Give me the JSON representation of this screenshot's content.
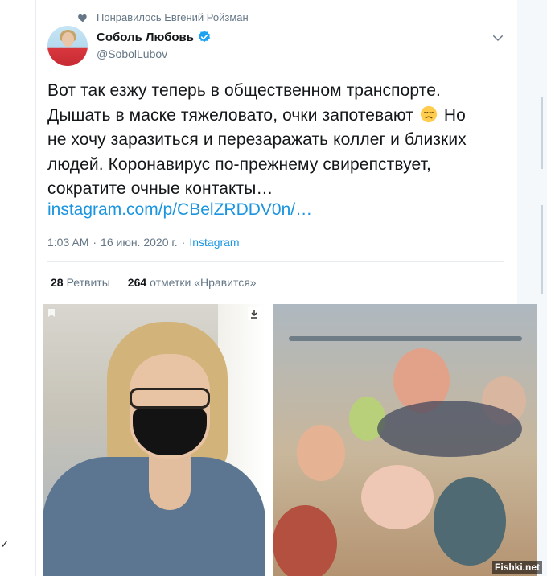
{
  "social_context": {
    "text": "Понравилось Евгений Ройзман",
    "icon": "heart-icon"
  },
  "author": {
    "name": "Соболь Любовь",
    "handle": "@SobolLubov",
    "verified": true
  },
  "tweet": {
    "line1": "Вот так езжу теперь в общественном транспорте.",
    "line2_before_emoji": "Дышать в маске тяжеловато, очки запотевают",
    "line2_after_emoji": "Но",
    "line3": "не хочу заразиться и перезаражать коллег и близких",
    "line4": "людей. Коронавирус по-прежнему свирепствует,",
    "line5": "сократите очные контакты…",
    "emoji": "disappointed-face",
    "link": "instagram.com/p/CBelZRDDV0n/…"
  },
  "meta": {
    "time": "1:03 AM",
    "separator": "·",
    "date": "16 июн. 2020 г.",
    "source": "Instagram"
  },
  "stats": {
    "retweets_count": "28",
    "retweets_label": "Ретвиты",
    "likes_count": "264",
    "likes_label": "отметки «Нравится»"
  },
  "watermark": "Fishki.net",
  "colors": {
    "link": "#1b95e0",
    "secondary": "#657786",
    "verified": "#1da1f2"
  }
}
